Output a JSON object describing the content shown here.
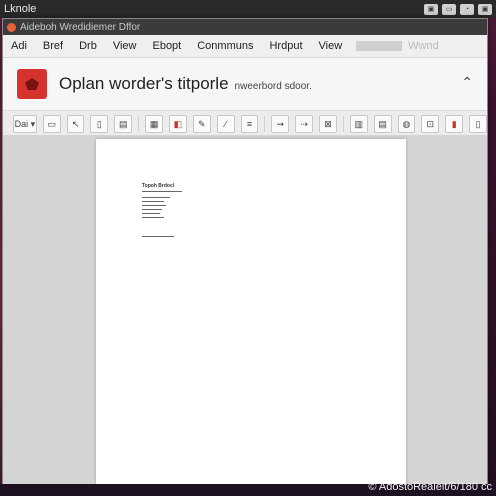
{
  "top_panel": {
    "label": "Lknole",
    "tray": [
      "▣",
      "▭",
      "◔",
      "▣"
    ]
  },
  "window": {
    "title": "Aideboh Wredidiemer Dffor"
  },
  "menubar": {
    "items": [
      "Adi",
      "Bref",
      "Drb",
      "View",
      "Ebopt",
      "Conmmuns",
      "Hrdput",
      "View",
      "Wwnd"
    ]
  },
  "document": {
    "title": "Oplan worder's titporle",
    "subtitle": "nweerbord sdoor.",
    "page_heading": "Topoh Brdocl"
  },
  "toolbar": {
    "zoom_label": "Dai ▾",
    "icons": [
      "page-icon",
      "select-icon",
      "bookmark-icon",
      "save-icon",
      "image-icon",
      "print-icon",
      "edit-icon",
      "highlight-icon",
      "move-icon",
      "signature-icon",
      "comment-icon",
      "mark-icon",
      "fit-icon",
      "layout-icon",
      "stamp-icon",
      "link-icon",
      "share-icon",
      "attach-icon"
    ]
  },
  "watermark": "© AdostoRealeit/6/180 cc"
}
